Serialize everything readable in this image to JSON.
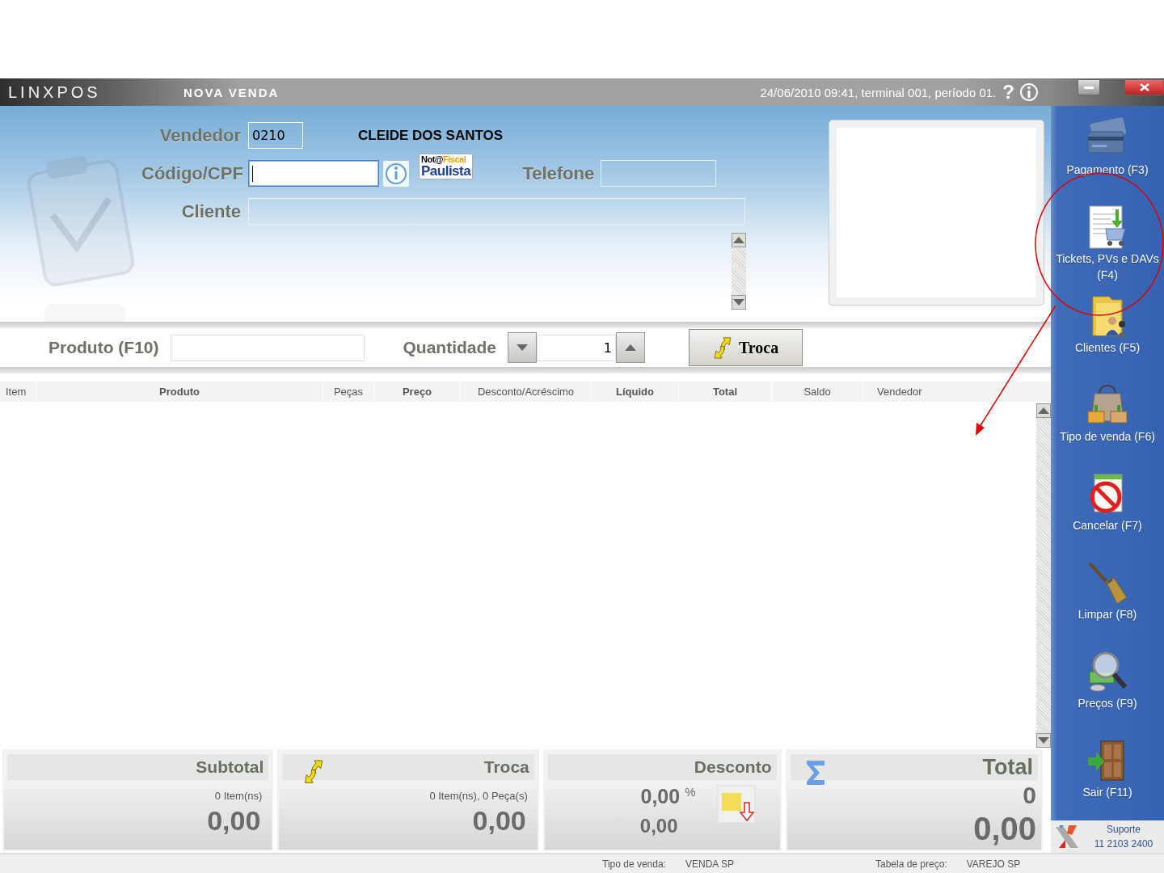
{
  "window": {
    "logo": "LINXPOS",
    "title": "NOVA VENDA",
    "info": "24/06/2010 09:41, terminal 001, período 01.",
    "help": "?"
  },
  "form": {
    "vendedor": {
      "label": "Vendedor",
      "value": "0210",
      "name": "CLEIDE DOS SANTOS"
    },
    "codigo": {
      "label": "Código/CPF",
      "focused": true
    },
    "nfp_logo": {
      "part_a": "Not@",
      "part_b": "Fiscal",
      "part_c": "Paulista"
    },
    "telefone": {
      "label": "Telefone"
    },
    "cliente": {
      "label": "Cliente"
    }
  },
  "product_bar": {
    "product_label": "Produto (F10)",
    "quantity_label": "Quantidade",
    "quantity": "1",
    "exchange_button": "Troca"
  },
  "table": {
    "columns": [
      {
        "label": "Item",
        "bold": false
      },
      {
        "label": "Produto",
        "bold": true
      },
      {
        "label": "Peças",
        "bold": false
      },
      {
        "label": "Preço",
        "bold": true
      },
      {
        "label": "Desconto/Acréscimo",
        "bold": false
      },
      {
        "label": "Líquido",
        "bold": true
      },
      {
        "label": "Total",
        "bold": true
      },
      {
        "label": "Saldo",
        "bold": false
      },
      {
        "label": "Vendedor",
        "bold": false
      }
    ]
  },
  "totals": [
    {
      "kind": "subtotal",
      "title": "Subtotal",
      "count": "0 Item(ns)",
      "value": "0,00"
    },
    {
      "kind": "exchange",
      "title": "Troca",
      "count": "0 Item(ns), 0 Peça(s)",
      "value": "0,00"
    },
    {
      "kind": "discount",
      "title": "Desconto",
      "percent": "0,00",
      "percent_sign": "%",
      "value": "0,00"
    },
    {
      "kind": "total",
      "title": "Total",
      "count": "0",
      "value": "0,00"
    }
  ],
  "sidebar": {
    "items": [
      {
        "kind": "payment",
        "label": "Pagamento (F3)"
      },
      {
        "kind": "tickets",
        "label": "Tickets, PVs e DAVs (F4)"
      },
      {
        "kind": "clients",
        "label": "Clientes (F5)"
      },
      {
        "kind": "sale-type",
        "label": "Tipo de venda (F6)"
      },
      {
        "kind": "cancel",
        "label": "Cancelar (F7)"
      },
      {
        "kind": "clean",
        "label": "Limpar (F8)"
      },
      {
        "kind": "prices",
        "label": "Preços (F9)"
      },
      {
        "kind": "exit",
        "label": "Sair (F11)"
      }
    ],
    "support": {
      "title": "Suporte",
      "phone": "11 2103 2400"
    }
  },
  "status_bar": [
    {
      "label": "Tipo de venda:",
      "value": "VENDA SP"
    },
    {
      "label": "Tabela de preço:",
      "value": "VAREJO SP"
    }
  ],
  "annotation": {
    "kind": "circle-arrow"
  }
}
